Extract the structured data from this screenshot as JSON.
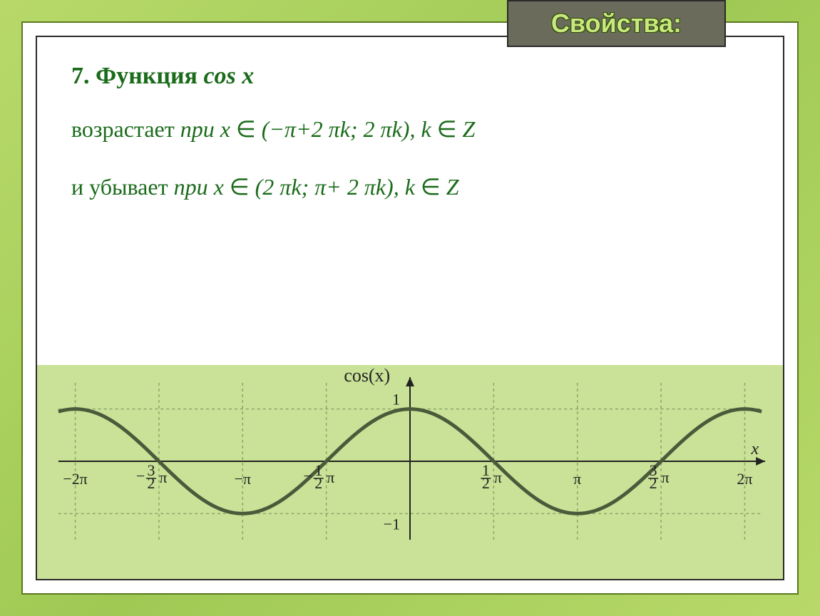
{
  "header": {
    "title": "Свойства:"
  },
  "heading": {
    "prefix": "7. Функция ",
    "func": "cos x"
  },
  "line1": {
    "word": "возрастает ",
    "pri": "при x ",
    "in": "∈ ",
    "expr": "(−π+2 πk; 2 πk), k ",
    "in2": "∈ ",
    "set": "Z"
  },
  "line2": {
    "word": "и убывает ",
    "pri": "при x ",
    "in": "∈ ",
    "expr": "(2 πk; π+ 2 πk), k ",
    "in2": "∈ ",
    "set": "Z"
  },
  "chart_data": {
    "type": "line",
    "title": "cos(x)",
    "x": [
      -6.2832,
      -5.4978,
      -4.7124,
      -3.927,
      -3.1416,
      -2.3562,
      -1.5708,
      -0.7854,
      0,
      0.7854,
      1.5708,
      2.3562,
      3.1416,
      3.927,
      4.7124,
      5.4978,
      6.2832
    ],
    "values": [
      1,
      0.7071,
      0,
      -0.7071,
      -1,
      -0.7071,
      0,
      0.7071,
      1,
      0.7071,
      0,
      -0.7071,
      -1,
      -0.7071,
      0,
      0.7071,
      1
    ],
    "xlabel": "x",
    "xticks_vals": [
      -6.2832,
      -4.7124,
      -3.1416,
      -1.5708,
      0,
      1.5708,
      3.1416,
      4.7124,
      6.2832
    ],
    "xticks_labels": [
      "−2π",
      "−3/2 π",
      "−π",
      "−1/2 π",
      "",
      "1/2 π",
      "π",
      "3/2 π",
      "2π"
    ],
    "yticks": [
      -1,
      1
    ],
    "xlim": [
      -6.6,
      6.6
    ],
    "ylim": [
      -1.5,
      1.5
    ]
  }
}
